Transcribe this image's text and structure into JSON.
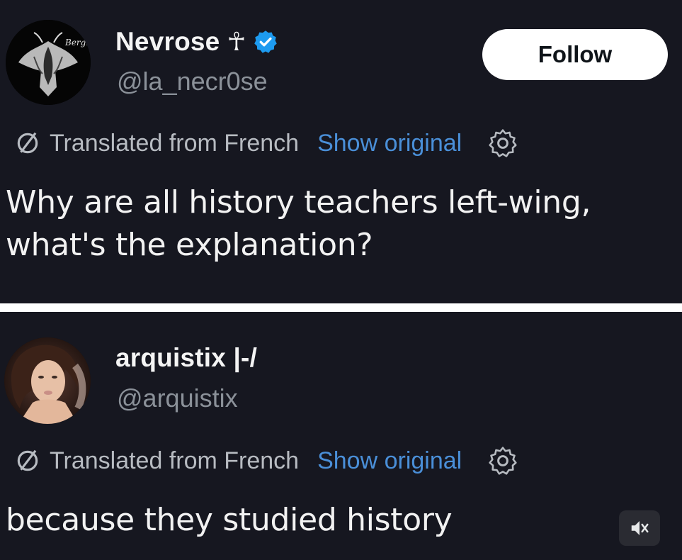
{
  "tweet_1": {
    "display_name": "Nevrose",
    "name_glyph": "☥",
    "handle": "@la_necr0se",
    "follow_label": "Follow",
    "avatar_logo_text": "Bergm",
    "verified_color": "#1d9bf0",
    "translated_label": "Translated from French",
    "show_original_label": "Show original",
    "text_line_1": "Why are all history teachers left-wing,",
    "text_line_2": "what's the explanation?"
  },
  "tweet_2": {
    "display_name": "arquistix |-/",
    "handle": "@arquistix",
    "translated_label": "Translated from French",
    "show_original_label": "Show original",
    "text_line_1": "because they studied history"
  },
  "theme": {
    "background": "#161720",
    "link_color": "#4a8fd8",
    "muted_text": "#8b9199"
  },
  "icons": [
    "translate-icon",
    "gear-icon",
    "verified-badge-icon",
    "volume-muted-icon"
  ]
}
